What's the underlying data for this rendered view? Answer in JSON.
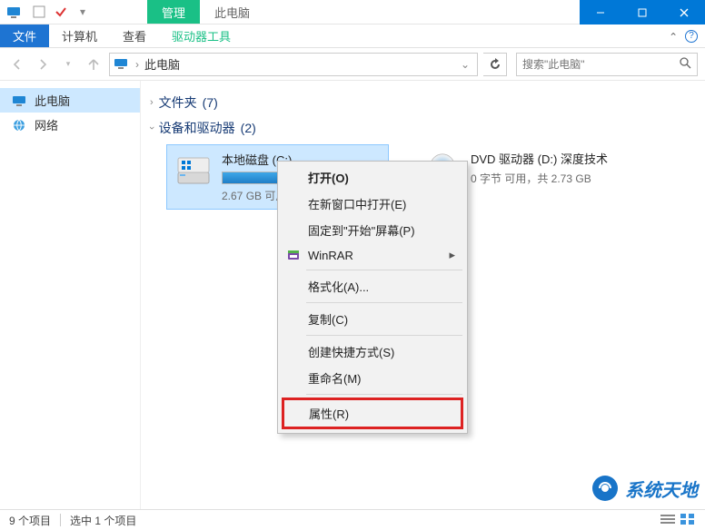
{
  "titlebar": {
    "manage_tab": "管理",
    "this_pc_tab": "此电脑"
  },
  "ribbon": {
    "file": "文件",
    "computer": "计算机",
    "view": "查看",
    "drive_tools": "驱动器工具"
  },
  "nav": {
    "breadcrumb_sep": "›",
    "location": "此电脑",
    "search_placeholder": "搜索\"此电脑\""
  },
  "sidebar": {
    "items": [
      {
        "label": "此电脑",
        "icon": "monitor",
        "active": true
      },
      {
        "label": "网络",
        "icon": "network",
        "active": false
      }
    ]
  },
  "groups": {
    "folders": {
      "label": "文件夹",
      "count": "(7)"
    },
    "devices": {
      "label": "设备和驱动器",
      "count": "(2)"
    }
  },
  "drives": [
    {
      "name": "本地磁盘 (C:)",
      "subtitle": "2.67 GB 可用",
      "fill_percent": 88,
      "selected": true,
      "icon": "hdd"
    },
    {
      "name": "DVD 驱动器 (D:) 深度技术",
      "subtitle": "0 字节 可用，共 2.73 GB",
      "fill_percent": 0,
      "selected": false,
      "icon": "dvd"
    }
  ],
  "context_menu": {
    "open": "打开(O)",
    "open_new_window": "在新窗口中打开(E)",
    "pin_start": "固定到\"开始\"屏幕(P)",
    "winrar": "WinRAR",
    "format": "格式化(A)...",
    "copy": "复制(C)",
    "create_shortcut": "创建快捷方式(S)",
    "rename": "重命名(M)",
    "properties": "属性(R)"
  },
  "status": {
    "items": "9 个项目",
    "selected": "选中 1 个项目"
  },
  "watermark": {
    "text": "系统天地"
  },
  "colors": {
    "accent": "#0078d7",
    "ribbon_green": "#1ac086",
    "selection": "#cde8ff"
  }
}
